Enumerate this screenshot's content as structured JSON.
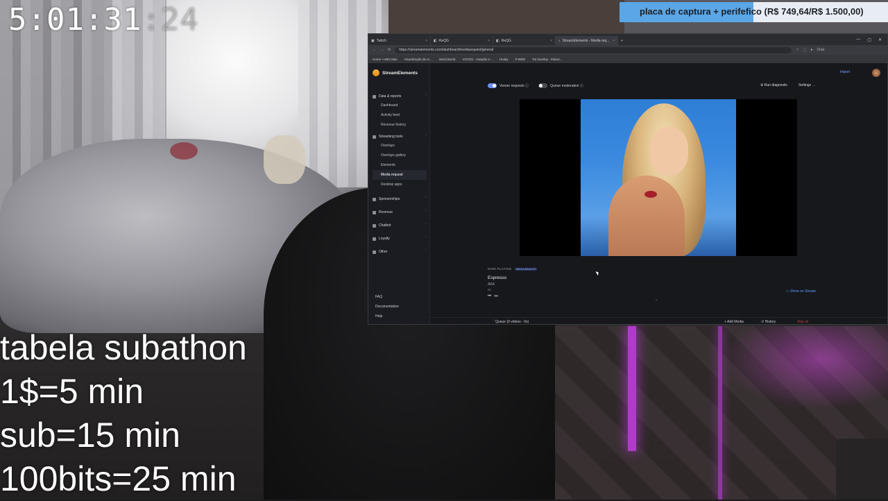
{
  "timer": {
    "main": "5:01:31",
    "ghost": ":24"
  },
  "goal": {
    "text": "placa de captura + perifefico (R$ 749,64/R$ 1.500,00)",
    "progress": 0.4998,
    "fill_color": "#5aa6e6",
    "bg_color": "#e8edf5"
  },
  "subathon": {
    "lines": [
      "tabela subathon",
      "1$=5 min",
      "sub=15 min",
      "100bits=25 min"
    ]
  },
  "browser": {
    "tabs": [
      {
        "label": "Twitch",
        "active": false
      },
      {
        "label": "ReQG",
        "active": false
      },
      {
        "label": "ReQG",
        "active": false
      },
      {
        "label": "StreamElements - Media req...",
        "active": true
      }
    ],
    "new_tab": "+",
    "url": "https://streamelements.com/dashboard/mediarequest/general",
    "chat_label": "Chat",
    "bookmarks": [
      "Home • HBO Max",
      "Visualização de m...",
      "Word Bomb",
      "VOTOS - Votação e...",
      "Husky",
      "P-8000",
      "Tut Overlay - Painei..."
    ]
  },
  "se": {
    "brand": "StreamElements",
    "import": "Import",
    "nav": [
      {
        "group": "Data & reports",
        "items": [
          "Dashboard",
          "Activity feed",
          "Revenue history"
        ]
      },
      {
        "group": "Streaming tools",
        "items": [
          "Overlays",
          "Overlays gallery",
          "Elements",
          "Media request",
          "Desktop apps"
        ],
        "active": "Media request"
      },
      {
        "group": "Sponsorships",
        "items": []
      },
      {
        "group": "Revenue",
        "items": []
      },
      {
        "group": "Chatbot",
        "items": []
      },
      {
        "group": "Loyalty",
        "items": []
      },
      {
        "group": "Other",
        "items": []
      }
    ],
    "bottom_nav": [
      "FAQ",
      "Documentation",
      "Help"
    ],
    "viewer_requests": "Viewer requests",
    "queue_moderation": "Queue moderation",
    "run_diagnostic": "Run diagnostic",
    "settings": "Settings",
    "now_playing": {
      "label": "NOW PLAYING",
      "badge": "MEDIA BACKUP",
      "title": "Espresso",
      "artist": "AKA",
      "time": "0s"
    },
    "show_on_stream": "Show on Stream",
    "queue": "Queue (0 videos - 0s)",
    "add_media": "Add Media",
    "history": "History",
    "skip": "Skip all"
  }
}
